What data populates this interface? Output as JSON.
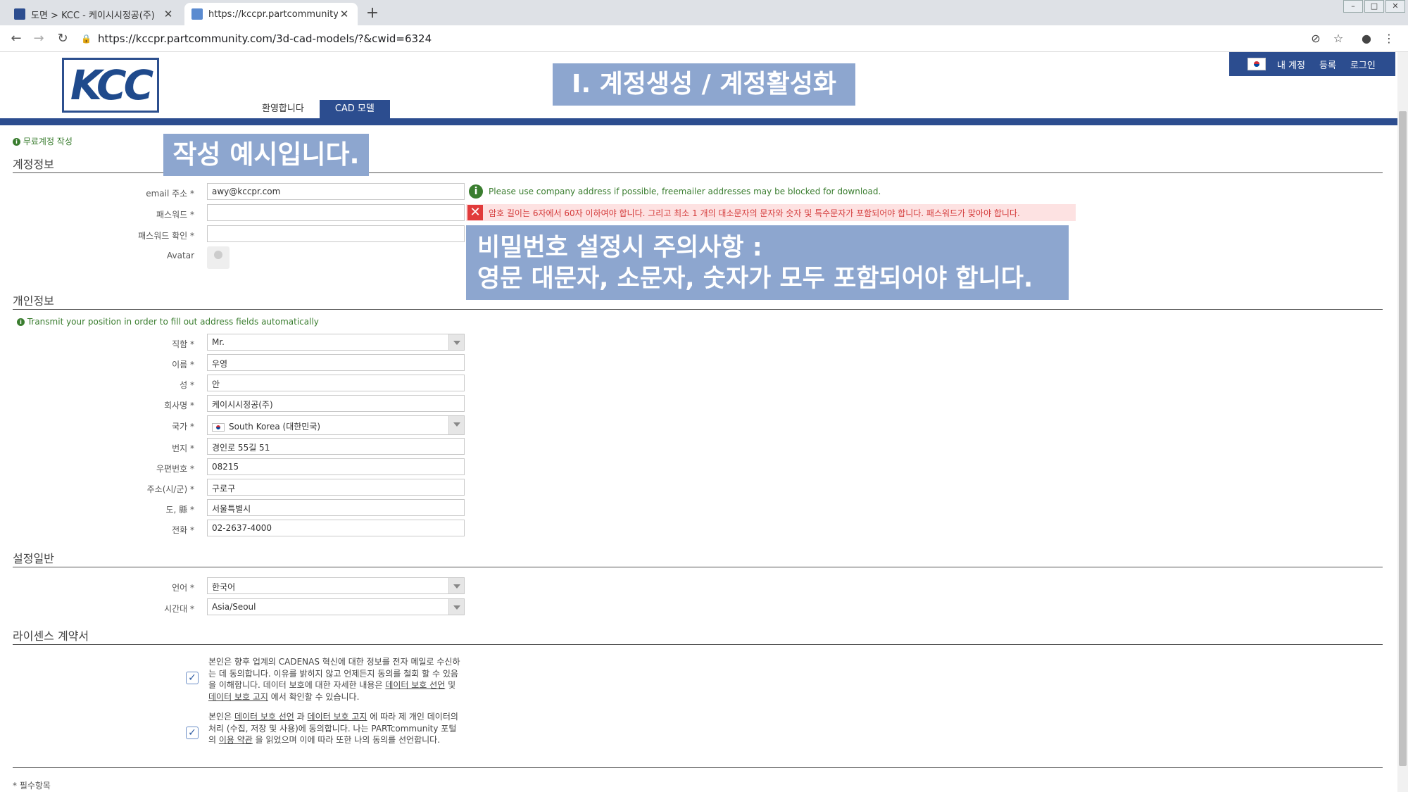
{
  "browser": {
    "tabs": [
      {
        "title": "도면 > KCC - 케이시시정공(주)",
        "favicon_color": "#2c4d8f"
      },
      {
        "title": "https://kccpr.partcommunity.com",
        "favicon_color": "#5b8bd0"
      }
    ],
    "url": "https://kccpr.partcommunity.com/3d-cad-models/?&cwid=6324"
  },
  "site": {
    "logo_text": "KCC",
    "nav_tabs": [
      {
        "label": "환영합니다"
      },
      {
        "label": "CAD 모델"
      }
    ],
    "user_menu": [
      {
        "label": "내 계정"
      },
      {
        "label": "등록"
      },
      {
        "label": "로그인"
      }
    ]
  },
  "overlays": {
    "heading": "Ⅰ. 계정생성 / 계정활성화",
    "example": "작성 예시입니다.",
    "notice_line1": "비밀번호 설정시 주의사항 :",
    "notice_line2": "영문 대문자, 소문자, 숫자가 모두 포함되어야 합니다."
  },
  "form": {
    "free_account": "무료계정 작성",
    "account_section": "계정정보",
    "email_label": "email 주소 *",
    "email_value": "awy@kccpr.com",
    "email_hint": "Please use company address if possible, freemailer addresses may be blocked for download.",
    "password_label": "패스워드 *",
    "password_error": "암호 길이는 6자에서 60자 이하여야 합니다. 그리고 최소 1 개의 대소문자의 문자와 숫자 및 특수문자가 포함되어야 합니다. 패스워드가 맞아야 합니다.",
    "password_confirm_label": "패스워드 확인 *",
    "avatar_label": "Avatar",
    "personal_section": "개인정보",
    "geo_hint": "Transmit your position in order to fill out address fields automatically",
    "title_label": "직함 *",
    "title_value": "Mr.",
    "firstname_label": "이름 *",
    "firstname_value": "우영",
    "lastname_label": "성 *",
    "lastname_value": "안",
    "company_label": "회사명 *",
    "company_value": "케이시시정공(주)",
    "country_label": "국가 *",
    "country_value": "South Korea (대한민국)",
    "street_label": "번지 *",
    "street_value": "경인로 55길 51",
    "zip_label": "우편번호 *",
    "zip_value": "08215",
    "city_label": "주소(시/군) *",
    "city_value": "구로구",
    "state_label": "도, 縣 *",
    "state_value": "서울특별시",
    "phone_label": "전화 *",
    "phone_value": "02-2637-4000",
    "settings_section": "설정일반",
    "language_label": "언어 *",
    "language_value": "한국어",
    "timezone_label": "시간대 *",
    "timezone_value": "Asia/Seoul",
    "license_section": "라이센스 계약서",
    "license1_a": "본인은 향후 업계의 CADENAS 혁신에 대한 정보를 전자 메일로 수신하는 데 동의합니다. 이유를 밝히지 않고 언제든지 동의를 철회 할 수 있음을 이해합니다. 데이터 보호에 대한 자세한 내용은 ",
    "license1_link1": "데이터 보호 선언",
    "license1_b": " 및 ",
    "license1_link2": "데이터 보호 고지",
    "license1_c": " 에서 확인할 수 있습니다.",
    "license2_a": "본인은 ",
    "license2_link1": "데이터 보호 선언",
    "license2_b": " 과 ",
    "license2_link2": "데이터 보호 고지",
    "license2_c": " 에 따라 제 개인 데이터의 처리 (수집, 저장 및 사용)에 동의합니다. 나는 PARTcommunity 포털의 ",
    "license2_link3": "이용 약관",
    "license2_d": " 을 읽었으며 이에 따라 또한 나의 동의를 선언합니다.",
    "required_note": "* 필수항목"
  }
}
